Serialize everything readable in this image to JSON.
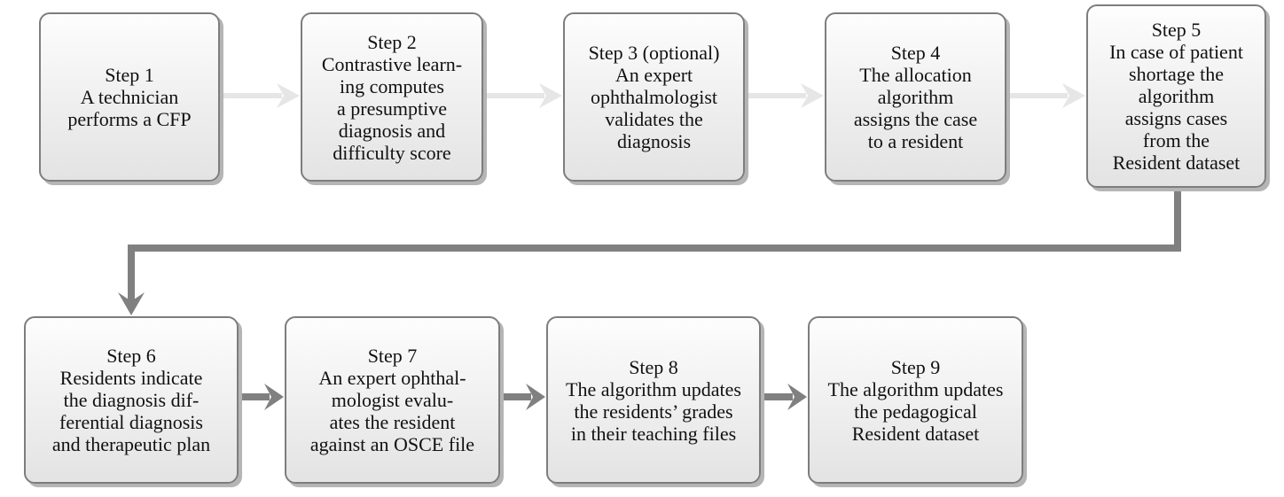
{
  "diagram": {
    "type": "flowchart",
    "colors": {
      "light_arrow": "#e6e6e6",
      "dark_arrow": "#808080",
      "box_border": "#7d7d7d",
      "box_fill_top": "#fdfdfd",
      "box_fill_bottom": "#e3e3e3"
    },
    "steps": [
      {
        "id": "step-1",
        "lines": [
          "Step 1",
          "A technician",
          "performs a CFP"
        ]
      },
      {
        "id": "step-2",
        "lines": [
          "Step 2",
          "Contrastive learn-",
          "ing computes",
          "a presumptive",
          "diagnosis and",
          "difficulty score"
        ]
      },
      {
        "id": "step-3",
        "lines": [
          "Step 3 (optional)",
          "An expert",
          "ophthalmologist",
          "validates the",
          "diagnosis"
        ]
      },
      {
        "id": "step-4",
        "lines": [
          "Step 4",
          "The allocation",
          "algorithm",
          "assigns the case",
          "to a resident"
        ]
      },
      {
        "id": "step-5",
        "lines": [
          "Step 5",
          "In case of patient",
          "shortage the",
          "algorithm",
          "assigns cases",
          "from the",
          "Resident dataset"
        ]
      },
      {
        "id": "step-6",
        "lines": [
          "Step 6",
          "Residents indicate",
          "the diagnosis dif-",
          "ferential diagnosis",
          "and therapeutic plan"
        ]
      },
      {
        "id": "step-7",
        "lines": [
          "Step 7",
          "An expert ophthal-",
          "mologist evalu-",
          "ates the resident",
          "against an OSCE file"
        ]
      },
      {
        "id": "step-8",
        "lines": [
          "Step 8",
          "The algorithm updates",
          "the residents’ grades",
          "in their teaching files"
        ]
      },
      {
        "id": "step-9",
        "lines": [
          "Step 9",
          "The algorithm updates",
          "the pedagogical",
          "Resident dataset"
        ]
      }
    ],
    "edges": [
      {
        "from": "step-1",
        "to": "step-2",
        "style": "light"
      },
      {
        "from": "step-2",
        "to": "step-3",
        "style": "light"
      },
      {
        "from": "step-3",
        "to": "step-4",
        "style": "light"
      },
      {
        "from": "step-4",
        "to": "step-5",
        "style": "light"
      },
      {
        "from": "step-5",
        "to": "step-6",
        "style": "dark"
      },
      {
        "from": "step-6",
        "to": "step-7",
        "style": "dark"
      },
      {
        "from": "step-7",
        "to": "step-8",
        "style": "dark"
      },
      {
        "from": "step-8",
        "to": "step-9",
        "style": "dark"
      }
    ]
  }
}
